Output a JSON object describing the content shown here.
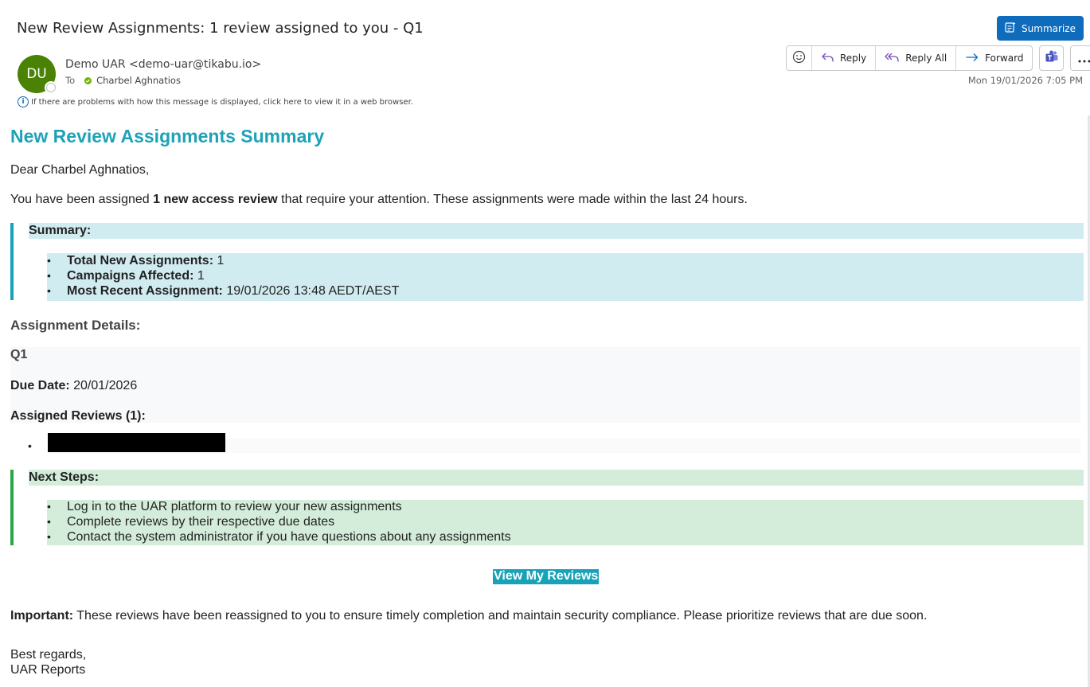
{
  "header": {
    "subject": "New Review Assignments: 1 review assigned to you - Q1",
    "summarize_label": "Summarize",
    "avatar_initials": "DU",
    "from": "Demo UAR <demo-uar@tikabu.io>",
    "to_label": "To",
    "to_name": "Charbel Aghnatios",
    "date": "Mon 19/01/2026 7:05 PM",
    "info_text": "If there are problems with how this message is displayed, click here to view it in a web browser.",
    "toolbar": {
      "reply": "Reply",
      "reply_all": "Reply All",
      "forward": "Forward"
    },
    "colors": {
      "accent": "#0f6cbd",
      "avatar": "#498205"
    }
  },
  "email": {
    "title": "New Review Assignments Summary",
    "greeting": "Dear Charbel Aghnatios,",
    "intro_pre": "You have been assigned ",
    "intro_bold": "1 new access review",
    "intro_post": " that require your attention. These assignments were made within the last 24 hours.",
    "summary": {
      "title": "Summary:",
      "items": [
        {
          "label": "Total New Assignments:",
          "value": " 1"
        },
        {
          "label": "Campaigns Affected:",
          "value": " 1"
        },
        {
          "label": "Most Recent Assignment:",
          "value": " 19/01/2026 13:48 AEDT/AEST"
        }
      ]
    },
    "details": {
      "heading": "Assignment Details:",
      "campaign": "Q1",
      "due_label": "Due Date:",
      "due_value": " 20/01/2026",
      "assigned_heading": "Assigned Reviews (1):"
    },
    "next_steps": {
      "title": "Next Steps:",
      "items": [
        "Log in to the UAR platform to review your new assignments",
        "Complete reviews by their respective due dates",
        "Contact the system administrator if you have questions about any assignments"
      ]
    },
    "cta": "View My Reviews",
    "important_label": "Important:",
    "important_text": " These reviews have been reassigned to you to ensure timely completion and maintain security compliance. Please prioritize reviews that are due soon.",
    "sign_off": "Best regards,",
    "signature": "UAR Reports",
    "colors": {
      "heading": "#1ea2b8",
      "info_bg": "#d1ecf1",
      "info_border": "#17a2b8",
      "success_bg": "#d4edda",
      "success_border": "#28a745",
      "cta_bg": "#17a2b8"
    }
  }
}
